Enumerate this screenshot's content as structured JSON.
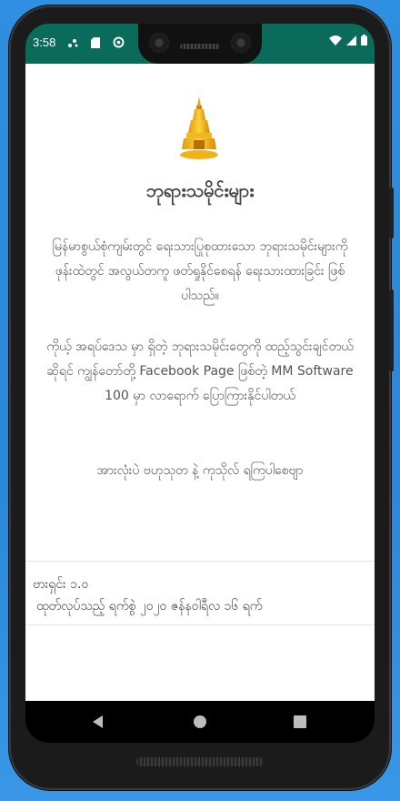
{
  "status_bar": {
    "time": "3:58",
    "icons_left": [
      "notification-dots-icon",
      "sd-card-icon",
      "sync-icon"
    ],
    "icons_right": [
      "wifi-icon",
      "signal-icon",
      "battery-icon"
    ],
    "background_color": "#0b6b5a"
  },
  "app": {
    "logo_icon": "pagoda-icon",
    "title": "ဘုရားသမိုင်းများ",
    "description": "မြန်မာစွယ်စုံကျမ်းတွင် ရေးသားပြုစုထားသော ဘုရားသမိုင်းများကို ဖုန်းထဲတွင် အလွယ်တကူ ဖတ်ရှုနိုင်စေရန် ရေးသားထားခြင်း ဖြစ်ပါသည်။",
    "contact_note": "ကိုယ့် အရပ်ဒေသ မှာ ရှိတဲ့ ဘုရားသမိုင်းတွေကို ထည့်သွင်းချင်တယ် ဆိုရင် ကျွန်တော်တို့ Facebook Page ဖြစ်တဲ့ MM Software 100 မှာ လာရောက် ပြောကြားနိုင်ပါတယ်",
    "blessing": "အားလုံးပဲ ဗဟုသုတ နဲ့ ကုသိုလ် ရကြပါစေဗျာ",
    "version_label": "ဗားရှင်း ၁.၀",
    "release_date": "ထုတ်လုပ်သည့် ရက်စွဲ ၂၀၂၀ ဇန်နဝါရီလ ၁၆ ရက်"
  },
  "navigation_bar": {
    "back": "back-triangle-icon",
    "home": "home-circle-icon",
    "recents": "recents-square-icon"
  }
}
